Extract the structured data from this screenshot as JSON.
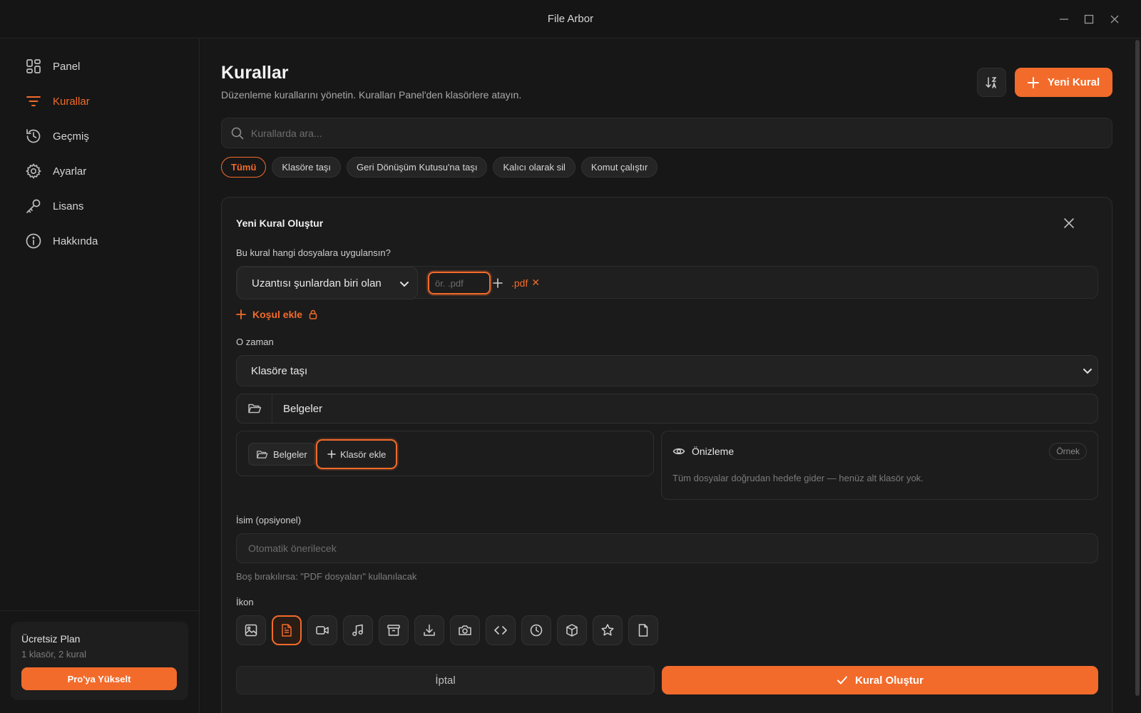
{
  "window": {
    "title": "File Arbor"
  },
  "sidebar": {
    "items": [
      {
        "label": "Panel",
        "icon": "grid-icon"
      },
      {
        "label": "Kurallar",
        "icon": "filter-icon",
        "active": true
      },
      {
        "label": "Geçmiş",
        "icon": "history-icon"
      },
      {
        "label": "Ayarlar",
        "icon": "gear-icon"
      },
      {
        "label": "Lisans",
        "icon": "key-icon"
      },
      {
        "label": "Hakkında",
        "icon": "info-icon"
      }
    ],
    "plan": {
      "title": "Ücretsiz Plan",
      "usage": "1 klasör, 2 kural",
      "upgrade_label": "Pro'ya Yükselt"
    }
  },
  "header": {
    "title": "Kurallar",
    "subtitle": "Düzenleme kurallarını yönetin. Kuralları Panel'den klasörlere atayın.",
    "new_rule_label": "Yeni Kural"
  },
  "search": {
    "placeholder": "Kurallarda ara..."
  },
  "filters": [
    "Tümü",
    "Klasöre taşı",
    "Geri Dönüşüm Kutusu'na taşı",
    "Kalıcı olarak sil",
    "Komut çalıştır"
  ],
  "form": {
    "title": "Yeni Kural Oluştur",
    "condition_label": "Bu kural hangi dosyalara uygulansın?",
    "condition_select": "Uzantısı şunlardan biri olan",
    "extension_placeholder": "ör. .pdf",
    "extension_tag": ".pdf",
    "remove_symbol": "✕",
    "add_condition_label": "Koşul ekle",
    "then_label": "O zaman",
    "action_select": "Klasöre taşı",
    "destination_folder": "Belgeler",
    "subfolder_chip": "Belgeler",
    "add_folder_label": "Klasör ekle",
    "preview": {
      "title": "Önizleme",
      "badge": "Örnek",
      "description": "Tüm dosyalar doğrudan hedefe gider — henüz alt klasör yok."
    },
    "name_label": "İsim (opsiyonel)",
    "name_placeholder": "Otomatik önerilecek",
    "name_hint": "Boş bırakılırsa: \"PDF dosyaları\" kullanılacak",
    "icon_label": "İkon",
    "icons": [
      "image-icon",
      "document-icon",
      "video-icon",
      "music-icon",
      "archive-icon",
      "download-icon",
      "camera-icon",
      "code-icon",
      "clock-icon",
      "package-icon",
      "star-icon",
      "file-icon"
    ],
    "selected_icon": "document-icon",
    "cancel_label": "İptal",
    "create_label": "Kural Oluştur"
  },
  "colors": {
    "accent": "#f26b2b",
    "background": "#151515",
    "card": "#1b1b1b"
  }
}
